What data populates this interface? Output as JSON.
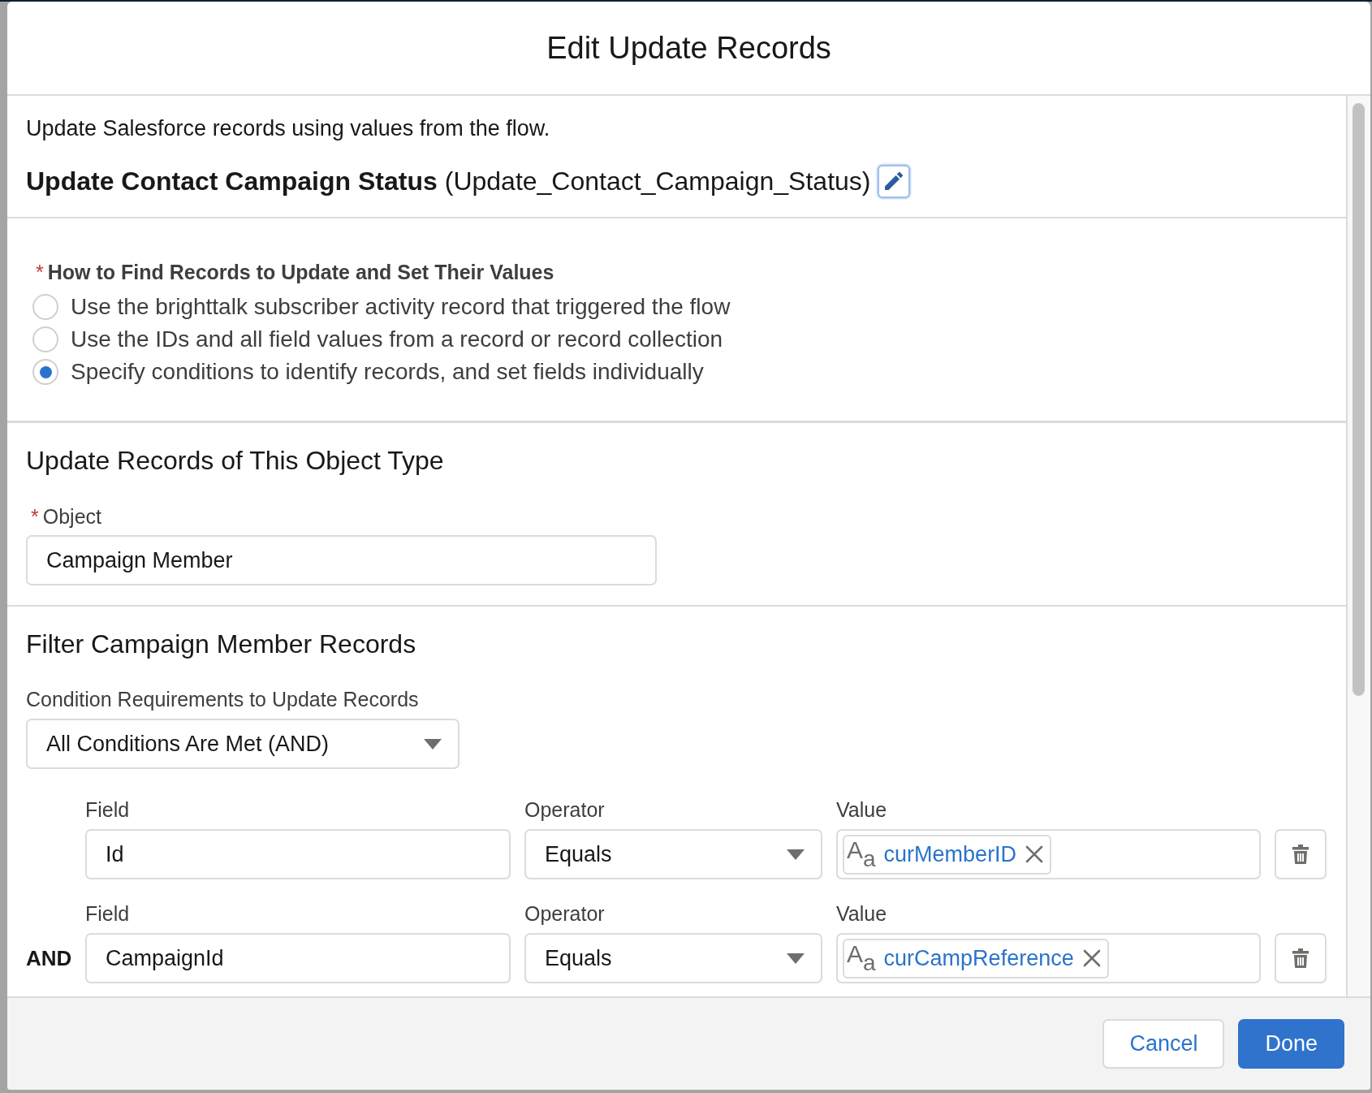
{
  "modal": {
    "title": "Edit Update Records"
  },
  "description": "Update Salesforce records using values from the flow.",
  "element": {
    "label": "Update Contact Campaign Status",
    "api_name": "(Update_Contact_Campaign_Status)"
  },
  "record_selection": {
    "required_mark": "*",
    "label": "How to Find Records to Update and Set Their Values",
    "options": [
      {
        "label": "Use the brighttalk subscriber activity record that triggered the flow",
        "selected": false
      },
      {
        "label": "Use the IDs and all field values from a record or record collection",
        "selected": false
      },
      {
        "label": "Specify conditions to identify records, and set fields individually",
        "selected": true
      }
    ]
  },
  "object_section": {
    "heading": "Update Records of This Object Type",
    "field": {
      "required_mark": "*",
      "label": "Object",
      "value": "Campaign Member"
    }
  },
  "filter_section": {
    "heading": "Filter Campaign Member Records",
    "requirement": {
      "label": "Condition Requirements to Update Records",
      "value": "All Conditions Are Met (AND)"
    },
    "conditions": [
      {
        "field_label": "Field",
        "field": "Id",
        "operator_label": "Operator",
        "operator": "Equals",
        "value_label": "Value",
        "value": {
          "type_icon": "A$_{a}$",
          "text": "curMemberID"
        }
      },
      {
        "logic": "AND",
        "field_label": "Field",
        "field": "CampaignId",
        "operator_label": "Operator",
        "operator": "Equals",
        "value_label": "Value",
        "value": {
          "type_icon": "A$_{a}$",
          "text": "curCampReference"
        }
      }
    ]
  },
  "footer": {
    "buttons": [
      {
        "label": "Cancel",
        "kind": "neutral"
      },
      {
        "label": "Done",
        "kind": "brand"
      }
    ]
  }
}
